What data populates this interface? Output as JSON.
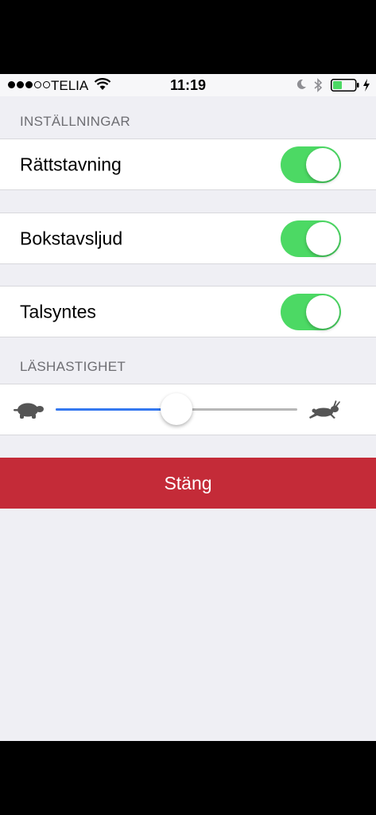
{
  "status_bar": {
    "carrier": "TELIA",
    "time": "11:19",
    "signal_icon": "signal-dots-icon",
    "wifi_icon": "wifi-icon",
    "moon_icon": "do-not-disturb-moon-icon",
    "bluetooth_icon": "bluetooth-icon",
    "battery_icon": "battery-icon",
    "charging_icon": "charging-bolt-icon"
  },
  "settings": {
    "header": "INSTÄLLNINGAR",
    "items": [
      {
        "label": "Rättstavning",
        "on": true
      },
      {
        "label": "Bokstavsljud",
        "on": true
      },
      {
        "label": "Talsyntes",
        "on": true
      }
    ]
  },
  "reading_speed": {
    "header": "LÄSHASTIGHET",
    "value_fraction": 0.5,
    "slow_icon": "turtle-icon",
    "fast_icon": "rabbit-icon"
  },
  "close_button": {
    "label": "Stäng"
  },
  "colors": {
    "switch_on": "#4cd964",
    "slider_fill": "#3478f0",
    "close_button": "#c42b38",
    "background": "#efeff4"
  }
}
